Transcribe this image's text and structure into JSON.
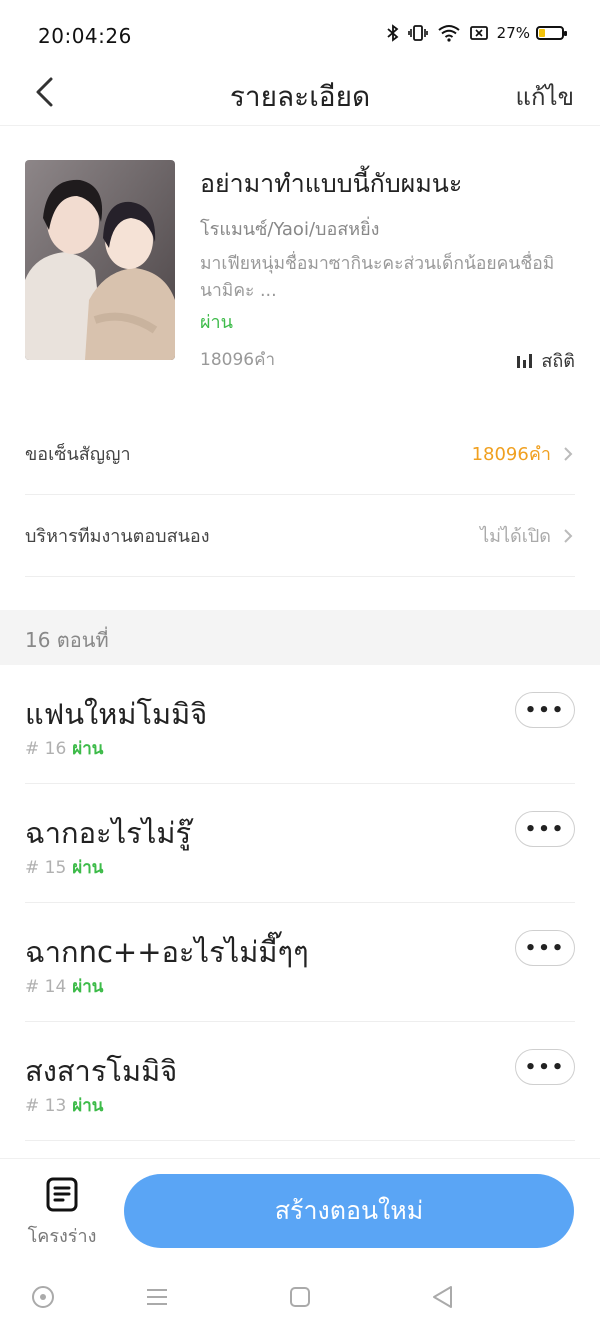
{
  "status_bar": {
    "time": "20:04:26",
    "battery_percent": "27%",
    "battery_level": 0.27,
    "icons": [
      "bluetooth-icon",
      "vibrate-icon",
      "wifi-icon",
      "sim-icon",
      "battery-icon"
    ]
  },
  "header": {
    "back_icon": "chevron-left-icon",
    "title": "รายละเอียด",
    "edit_label": "แก้ไข"
  },
  "book": {
    "title": "อย่ามาทำแบบนี้กับผมนะ",
    "genre": "โรแมนซ์/Yaoi/บอสหยิ่ง",
    "description": "มาเฟียหนุ่มชื่อมาซากินะคะส่วนเด็กน้อยคนชื่อมินามิคะ ...",
    "status": "ผ่าน",
    "word_count": "18096คำ",
    "stats_label": "สถิติ",
    "colors": {
      "status": "#3dbb49"
    }
  },
  "settings": [
    {
      "label": "ขอเซ็นสัญญา",
      "value": "18096คำ",
      "value_color": "#f0a020"
    },
    {
      "label": "บริหารทีมงานตอบสนอง",
      "value": "ไม่ได้เปิด",
      "value_color": "#aaaaaa"
    }
  ],
  "chapters_header": "16 ตอนที่",
  "chapters": [
    {
      "title": "แฟนใหม่โมมิจิ",
      "number": "# 16",
      "status": "ผ่าน"
    },
    {
      "title": "ฉากอะไรไม่รู๊",
      "number": "# 15",
      "status": "ผ่าน"
    },
    {
      "title": "ฉากnc++อะไรไม่มี๊ๆๆ",
      "number": "# 14",
      "status": "ผ่าน"
    },
    {
      "title": "สงสารโมมิจิ",
      "number": "# 13",
      "status": "ผ่าน"
    }
  ],
  "more_label": "•••",
  "bottom_bar": {
    "outline_label": "โครงร่าง",
    "create_label": "สร้างตอนใหม่",
    "accent": "#5aa5f5"
  },
  "nav_bar": [
    "assistant-circle-icon",
    "menu-icon",
    "home-square-icon",
    "back-triangle-icon"
  ]
}
